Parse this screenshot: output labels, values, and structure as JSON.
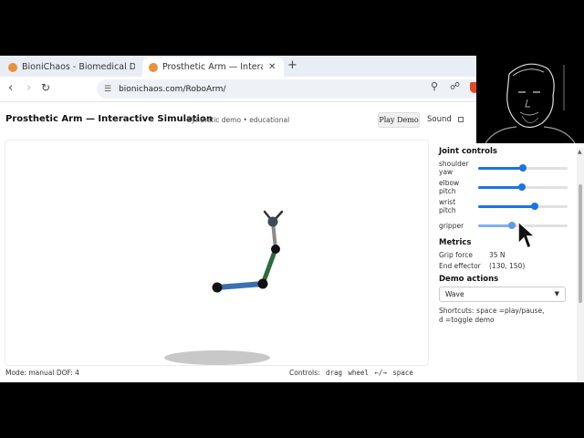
{
  "browser": {
    "tabs": [
      {
        "title": "BioniChaos - Biomedical Data",
        "active": false
      },
      {
        "title": "Prosthetic Arm — Interactive",
        "active": true
      }
    ],
    "new_tab": "+",
    "close": "✕",
    "url": "bionichaos.com/RoboArm/"
  },
  "header": {
    "title": "Prosthetic Arm — Interactive Simulation",
    "subtitle": "Synthetic demo • educational",
    "play_button": "Play Demo",
    "sound_label": "Sound",
    "sound_checked": false
  },
  "joint_controls": {
    "heading": "Joint controls",
    "sliders": [
      {
        "label": "shoulder yaw",
        "value": 0.5
      },
      {
        "label": "elbow pitch",
        "value": 0.49
      },
      {
        "label": "wrist pitch",
        "value": 0.63
      },
      {
        "label": "gripper",
        "value": 0.38
      }
    ]
  },
  "metrics": {
    "heading": "Metrics",
    "grip_force_label": "Grip force",
    "grip_force_value": "35 N",
    "end_effector_label": "End effector",
    "end_effector_value": "(130, 150)"
  },
  "demo_actions": {
    "heading": "Demo actions",
    "selected": "Wave"
  },
  "shortcuts": {
    "prefix": "Shortcuts:",
    "key1": "space",
    "desc1": "=play/pause,",
    "key2": "d",
    "desc2": "=toggle demo"
  },
  "status": {
    "mode": "Mode: manual  DOF: 4",
    "controls_label": "Controls:",
    "keys": [
      "drag",
      "wheel",
      "←/→",
      "space"
    ]
  },
  "colors": {
    "accent": "#1a73e8",
    "upper_arm": "#3b6fb0",
    "forearm": "#2e6b3c",
    "wrist": "#8a8a8a",
    "joint": "#111111"
  }
}
